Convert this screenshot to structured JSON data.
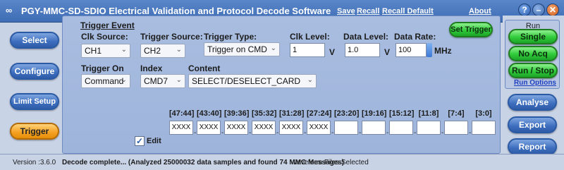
{
  "app": {
    "title": "PGY-MMC-SD-SDIO Electrical Validation and Protocol Decode Software",
    "links": {
      "save": "Save",
      "recall": "Recall",
      "recall_default": "Recall Default",
      "about": "About"
    },
    "window_buttons": {
      "help": "?",
      "minimize": "–",
      "close": "✕"
    }
  },
  "nav": {
    "items": [
      {
        "label": "Select",
        "active": false
      },
      {
        "label": "Configure",
        "active": false
      },
      {
        "label": "Limit Setup",
        "active": false
      },
      {
        "label": "Trigger",
        "active": true
      }
    ]
  },
  "trigger": {
    "section_title": "Trigger Event",
    "clk_source": {
      "label": "Clk Source:",
      "value": "CH1"
    },
    "trigger_source": {
      "label": "Trigger Source:",
      "value": "CH2"
    },
    "trigger_type": {
      "label": "Trigger Type:",
      "value": "Trigger on CMD"
    },
    "clk_level": {
      "label": "Clk Level:",
      "value": "1",
      "unit": "V"
    },
    "data_level": {
      "label": "Data Level:",
      "value": "1.0",
      "unit": "V"
    },
    "data_rate": {
      "label": "Data Rate:",
      "value": "100",
      "unit": "MHz"
    },
    "set_trigger": "Set Trigger",
    "trigger_on": {
      "label": "Trigger On",
      "value": "Command"
    },
    "index": {
      "label": "Index",
      "value": "CMD7"
    },
    "content": {
      "label": "Content",
      "value": "SELECT/DESELECT_CARD"
    },
    "edit": {
      "label": "Edit",
      "checked": "✓"
    },
    "bits": [
      {
        "range": "[47:44]",
        "value": "XXXX"
      },
      {
        "range": "[43:40]",
        "value": "XXXX"
      },
      {
        "range": "[39:36]",
        "value": "XXXX"
      },
      {
        "range": "[35:32]",
        "value": "XXXX"
      },
      {
        "range": "[31:28]",
        "value": "XXXX"
      },
      {
        "range": "[27:24]",
        "value": "XXXX"
      },
      {
        "range": "[23:20]",
        "value": ""
      },
      {
        "range": "[19:16]",
        "value": ""
      },
      {
        "range": "[15:12]",
        "value": ""
      },
      {
        "range": "[11:8]",
        "value": ""
      },
      {
        "range": "[7:4]",
        "value": ""
      },
      {
        "range": "[3:0]",
        "value": ""
      }
    ],
    "separator": "-"
  },
  "run": {
    "title": "Run",
    "single": "Single",
    "no_acq": "No Acq",
    "run_stop": "Run / Stop",
    "run_options": "Run Options",
    "analyse": "Analyse",
    "export": "Export",
    "report": "Report"
  },
  "status": {
    "version": "Version :3.6.0",
    "message": "Decode complete... (Analyzed 25000032 data samples and found 74 MMC Messages)",
    "files": "Waveform Files Selected"
  },
  "colors": {
    "title_bar": "#3e6db5",
    "active_nav": "#f4a020",
    "green_button": "#2fcb3a",
    "panel": "#a9bde0"
  }
}
